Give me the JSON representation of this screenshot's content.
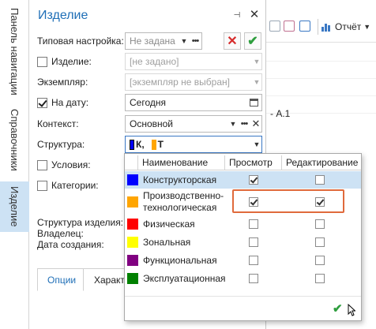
{
  "side_tabs": [
    "Панель навигации",
    "Справочники",
    "Изделие"
  ],
  "panel": {
    "title": "Изделие",
    "pin_glyph": "⊣",
    "close_glyph": "✕"
  },
  "form": {
    "typical_setting": {
      "label": "Типовая настройка:",
      "placeholder": "Не задана"
    },
    "product": {
      "label": "Изделие:",
      "value": "[не задано]",
      "checked": false
    },
    "instance": {
      "label": "Экземпляр:",
      "value": "[экземпляр не выбран]"
    },
    "on_date": {
      "label": "На дату:",
      "value": "Сегодня",
      "checked": true
    },
    "context": {
      "label": "Контекст:",
      "value": "Основной"
    },
    "structure": {
      "label": "Структура:",
      "value_k": "К,",
      "value_t": "Т"
    },
    "conditions": {
      "label": "Условия:",
      "checked": false
    },
    "categories": {
      "label": "Категории:",
      "checked": false
    },
    "info": {
      "structure_label": "Структура изделия:",
      "owner_label": "Владелец:",
      "created_label": "Дата создания:"
    }
  },
  "tabs": [
    "Опции",
    "Характ"
  ],
  "background": {
    "report_label": "Отчёт",
    "row_fragment": "- А.1"
  },
  "structure_popup": {
    "columns": [
      "Наименование",
      "Просмотр",
      "Редактирование"
    ],
    "rows": [
      {
        "name": "Конструкторская",
        "color": "#0000ff",
        "view": true,
        "edit": false
      },
      {
        "name": "Производственно-технологическая",
        "color": "#ffa500",
        "view": true,
        "edit": true
      },
      {
        "name": "Физическая",
        "color": "#ff0000",
        "view": false,
        "edit": false
      },
      {
        "name": "Зональная",
        "color": "#ffff00",
        "view": false,
        "edit": false
      },
      {
        "name": "Функциональная",
        "color": "#800080",
        "view": false,
        "edit": false
      },
      {
        "name": "Эксплуатационная",
        "color": "#008000",
        "view": false,
        "edit": false
      }
    ],
    "ok_glyph": "✔"
  },
  "colors": {
    "accent": "#1f6fb7",
    "selected_row": "#cde2f4",
    "highlight": "#e06a3c",
    "cancel_red": "#d62b2b",
    "ok_green": "#2e9e3e"
  }
}
